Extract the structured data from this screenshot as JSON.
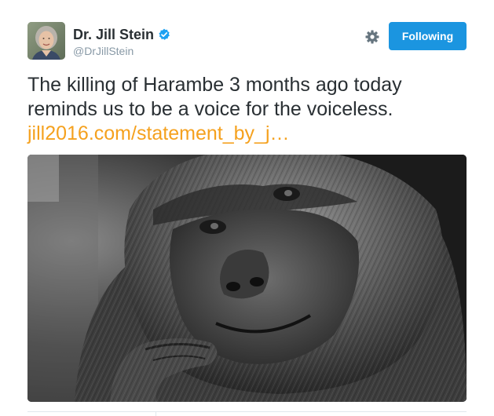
{
  "author": {
    "display_name": "Dr. Jill Stein",
    "handle": "@DrJillStein",
    "verified": true,
    "avatar_icon": "profile-photo"
  },
  "actions": {
    "settings_icon": "gear-icon",
    "follow_label": "Following",
    "follow_color": "#1b95e0"
  },
  "tweet": {
    "text_lines": [
      "The killing of Harambe 3 months ago today",
      "reminds us to be a voice for the voiceless."
    ],
    "link": "jill2016.com/statement_by_j…",
    "link_color": "#f5a11e"
  },
  "media": {
    "subject": "gorilla-photo"
  }
}
